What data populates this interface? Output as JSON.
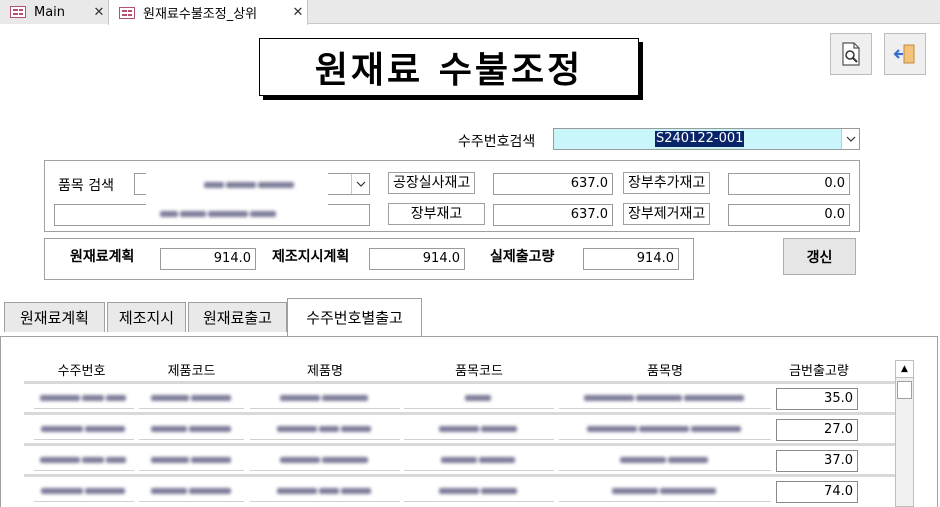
{
  "doc_tabs": [
    {
      "label": "Main",
      "close": "✕"
    },
    {
      "label": "원재료수불조정_상위",
      "close": "✕"
    }
  ],
  "title": "원재료 수불조정",
  "order_search": {
    "label": "수주번호검색",
    "value": "S240122-001"
  },
  "item_search": {
    "label": "품목 검색"
  },
  "stock": {
    "factory_label": "공장실사재고",
    "factory_value": "637.0",
    "ledger_label": "장부재고",
    "ledger_value": "637.0",
    "ledger_add_label": "장부추가재고",
    "ledger_add_value": "0.0",
    "ledger_remove_label": "장부제거재고",
    "ledger_remove_value": "0.0"
  },
  "plan": {
    "material_label": "원재료계획",
    "material_value": "914.0",
    "production_label": "제조지시계획",
    "production_value": "914.0",
    "actual_label": "실제출고량",
    "actual_value": "914.0"
  },
  "refresh_label": "갱신",
  "sub_tabs": [
    "원재료계획",
    "제조지시",
    "원재료출고",
    "수주번호별출고"
  ],
  "grid": {
    "headers": [
      "수주번호",
      "제품코드",
      "제품명",
      "품목코드",
      "품목명",
      "금번출고량"
    ],
    "qty": [
      "35.0",
      "27.0",
      "37.0",
      "74.0"
    ]
  },
  "icons": {
    "preview": "print-preview-icon",
    "exit": "exit-door-icon"
  }
}
